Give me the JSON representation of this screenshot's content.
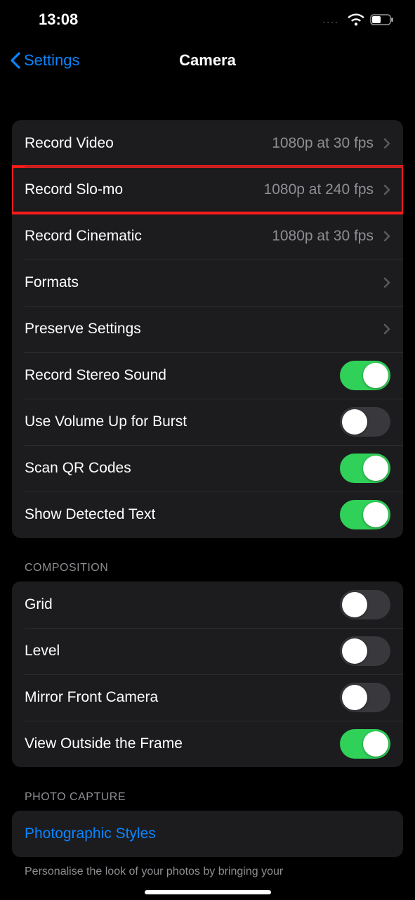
{
  "status": {
    "time": "13:08",
    "dots": "....",
    "wifi": true,
    "battery_fraction": 0.45
  },
  "nav": {
    "back_label": "Settings",
    "title": "Camera"
  },
  "section1": {
    "record_video": {
      "label": "Record Video",
      "detail": "1080p at 30 fps"
    },
    "record_slomo": {
      "label": "Record Slo-mo",
      "detail": "1080p at 240 fps",
      "highlighted": true
    },
    "record_cinematic": {
      "label": "Record Cinematic",
      "detail": "1080p at 30 fps"
    },
    "formats": {
      "label": "Formats"
    },
    "preserve_settings": {
      "label": "Preserve Settings"
    },
    "stereo_sound": {
      "label": "Record Stereo Sound",
      "on": true
    },
    "volume_burst": {
      "label": "Use Volume Up for Burst",
      "on": false
    },
    "scan_qr": {
      "label": "Scan QR Codes",
      "on": true
    },
    "detected_text": {
      "label": "Show Detected Text",
      "on": true
    }
  },
  "composition": {
    "header": "COMPOSITION",
    "grid": {
      "label": "Grid",
      "on": false
    },
    "level": {
      "label": "Level",
      "on": false
    },
    "mirror_front": {
      "label": "Mirror Front Camera",
      "on": false
    },
    "view_outside": {
      "label": "View Outside the Frame",
      "on": true
    }
  },
  "photo_capture": {
    "header": "PHOTO CAPTURE",
    "photographic_styles": {
      "label": "Photographic Styles"
    },
    "footer": "Personalise the look of your photos by bringing your"
  }
}
